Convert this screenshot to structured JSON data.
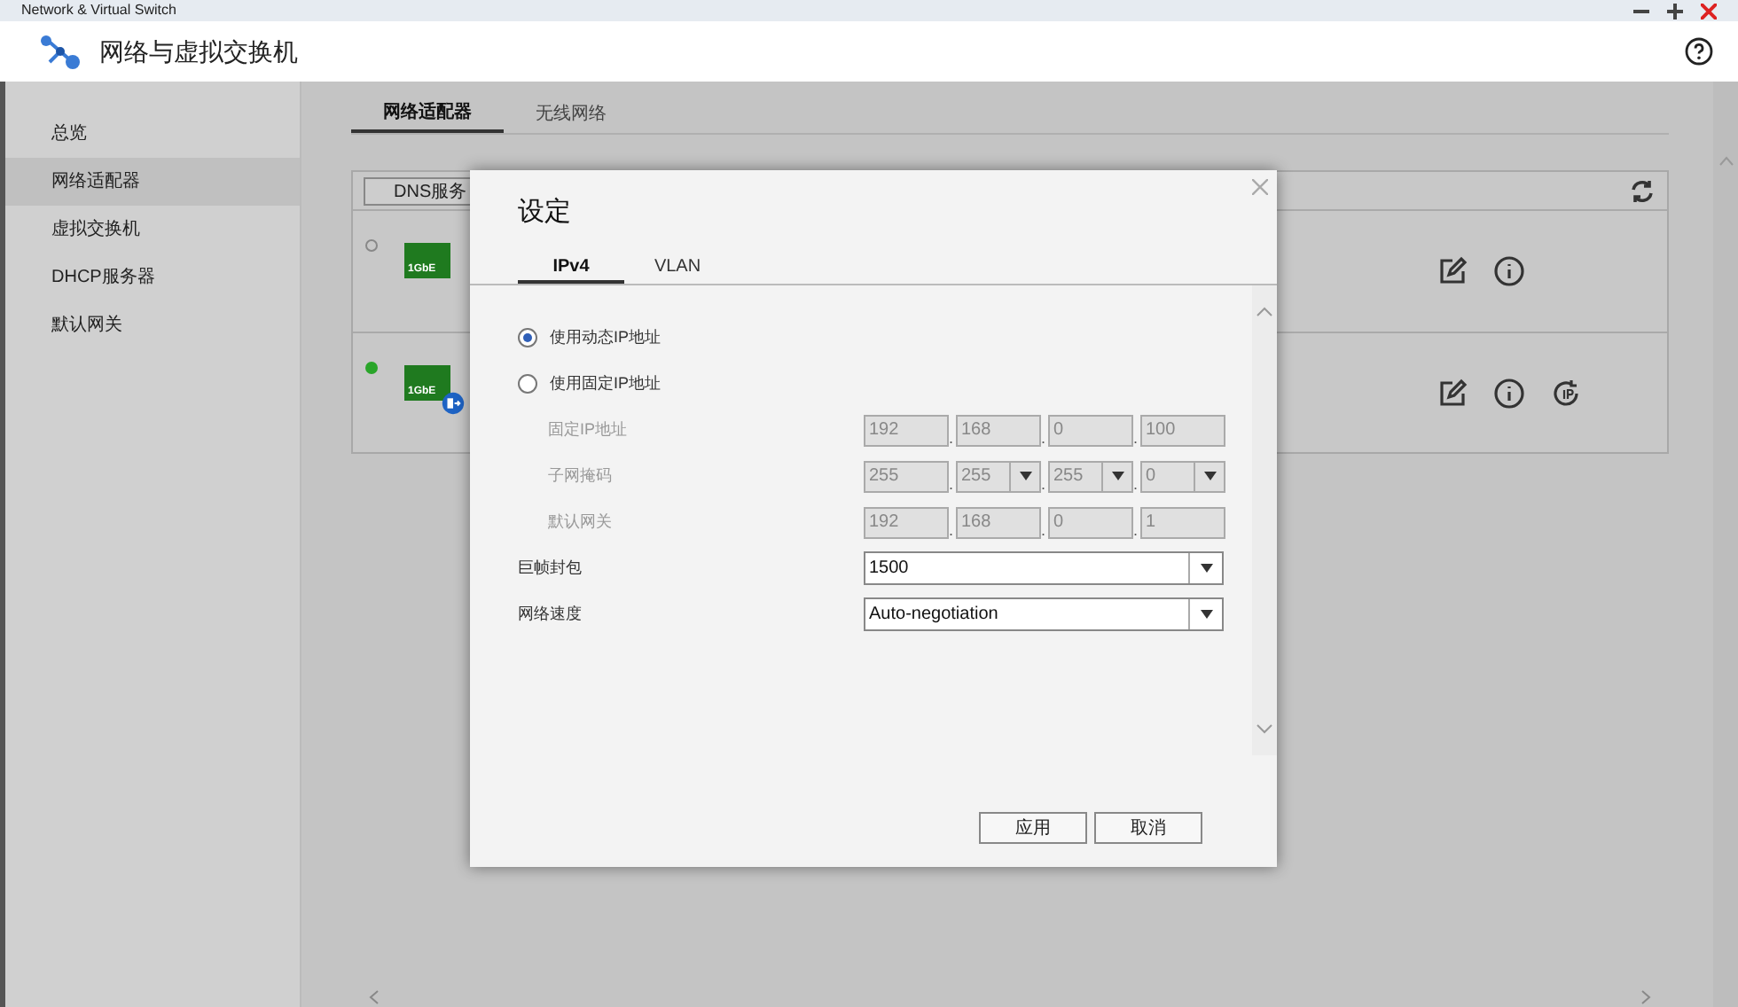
{
  "window": {
    "title": "Network & Virtual Switch"
  },
  "app": {
    "title": "网络与虚拟交换机"
  },
  "sidebar": {
    "items": [
      {
        "label": "总览",
        "selected": false
      },
      {
        "label": "网络适配器",
        "selected": true
      },
      {
        "label": "虚拟交换机",
        "selected": false
      },
      {
        "label": "DHCP服务器",
        "selected": false
      },
      {
        "label": "默认网关",
        "selected": false
      }
    ]
  },
  "tabs": [
    {
      "label": "网络适配器",
      "selected": true
    },
    {
      "label": "无线网络",
      "selected": false
    }
  ],
  "toolbar": {
    "button": "DNS服务"
  },
  "adapters": [
    {
      "connected": false,
      "port_label": "1GbE",
      "virtual_switch": false,
      "actions": [
        {
          "kind": "edit"
        },
        {
          "kind": "info"
        }
      ]
    },
    {
      "connected": true,
      "port_label": "1GbE",
      "virtual_switch": true,
      "actions": [
        {
          "kind": "edit"
        },
        {
          "kind": "info"
        },
        {
          "kind": "renew-ip"
        }
      ]
    }
  ],
  "dialog": {
    "title": "设定",
    "tabs": [
      {
        "label": "IPv4",
        "selected": true
      },
      {
        "label": "VLAN",
        "selected": false
      }
    ],
    "options": [
      {
        "label": "使用动态IP地址",
        "selected": true
      },
      {
        "label": "使用固定IP地址",
        "selected": false
      }
    ],
    "address_rows": [
      {
        "label": "固定IP地址",
        "disabled": true,
        "octets": [
          {
            "value": "192",
            "kind": "text"
          },
          {
            "separator": ".",
            "value": "168",
            "kind": "text"
          },
          {
            "separator": ".",
            "value": "0",
            "kind": "text"
          },
          {
            "separator": ".",
            "value": "100",
            "kind": "text"
          }
        ]
      },
      {
        "label": "子网掩码",
        "disabled": true,
        "octets": [
          {
            "value": "255",
            "kind": "text"
          },
          {
            "separator": ".",
            "value": "255",
            "kind": "select"
          },
          {
            "separator": ".",
            "value": "255",
            "kind": "select"
          },
          {
            "separator": ".",
            "value": "0",
            "kind": "select"
          }
        ]
      },
      {
        "label": "默认网关",
        "disabled": true,
        "octets": [
          {
            "value": "192",
            "kind": "text"
          },
          {
            "separator": ".",
            "value": "168",
            "kind": "text"
          },
          {
            "separator": ".",
            "value": "0",
            "kind": "text"
          },
          {
            "separator": ".",
            "value": "1",
            "kind": "text"
          }
        ]
      }
    ],
    "settings": [
      {
        "label": "巨帧封包",
        "value": "1500"
      },
      {
        "label": "网络速度",
        "value": "Auto-negotiation"
      }
    ],
    "buttons": [
      "应用",
      "取消"
    ]
  }
}
